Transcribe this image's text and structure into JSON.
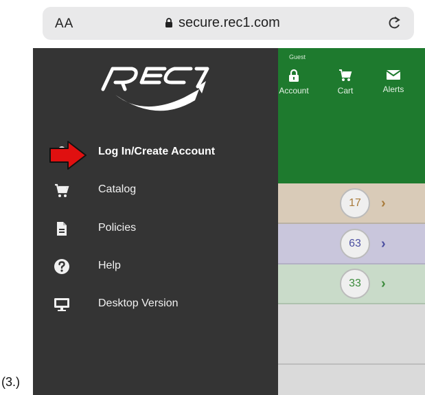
{
  "browser": {
    "text_size_label": "AA",
    "url": "secure.rec1.com"
  },
  "header": {
    "guest_label": "Guest",
    "icons": [
      {
        "label": "Account",
        "icon": "lock-icon"
      },
      {
        "label": "Cart",
        "icon": "cart-icon"
      },
      {
        "label": "Alerts",
        "icon": "envelope-icon"
      }
    ]
  },
  "drawer": {
    "logo_text": "REC1",
    "items": [
      {
        "label": "Log In/Create Account",
        "icon": "user-icon",
        "highlighted": true
      },
      {
        "label": "Catalog",
        "icon": "cart-icon"
      },
      {
        "label": "Policies",
        "icon": "document-icon"
      },
      {
        "label": "Help",
        "icon": "question-icon"
      },
      {
        "label": "Desktop Version",
        "icon": "monitor-icon"
      }
    ]
  },
  "rows": [
    {
      "count": "17",
      "color": "#a87a3a"
    },
    {
      "count": "63",
      "color": "#4a4ea0"
    },
    {
      "count": "33",
      "color": "#3b8a3b"
    }
  ],
  "annotation": {
    "arrow_color": "#e01010"
  },
  "caption": "(3.)"
}
